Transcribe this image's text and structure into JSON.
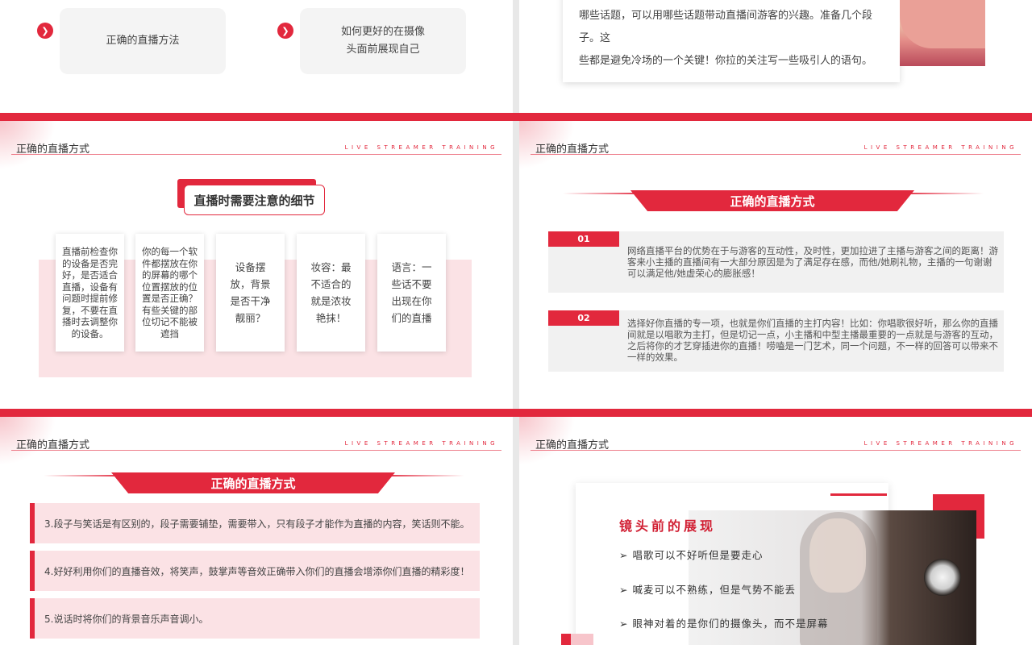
{
  "slide1": {
    "card1_text": "正确的直播方法",
    "card2_line1": "如何更好的在摄像",
    "card2_line2": "头面前展现自己",
    "arrow_icon": "chevron-right"
  },
  "slide2": {
    "line1": "哪些话题，可以用哪些话题带动直播间游客的兴趣。准备几个段子。这",
    "line2": "些都是避免冷场的一个关键！你拉的关注写一些吸引人的语句。"
  },
  "header": {
    "title": "正确的直播方式",
    "subtitle_en": "LIVE STREAMER TRAINING"
  },
  "slide3": {
    "tag": "直播时需要注意的细节",
    "cards": [
      "直播前检查你的设备是否完好，是否适合直播，设备有问题时提前修复，不要在直播时去调整你的设备。",
      "你的每一个软件都摆放在你的屏幕的哪个位置摆放的位置是否正确？有些关键的部位切记不能被遮挡",
      "设备摆放，背景是否干净靓丽？",
      "妆容：最不适合的就是浓妆艳抹！",
      "语言：一些话不要出现在你们的直播"
    ]
  },
  "slide4": {
    "banner": "正确的直播方式",
    "rows": [
      {
        "num": "01",
        "text": "网络直播平台的优势在于与游客的互动性，及时性，更加拉进了主播与游客之间的距离！游客来小主播的直播间有一大部分原因是为了满足存在感，而他/她刷礼物，主播的一句谢谢可以满足他/她虚荣心的膨胀感！"
      },
      {
        "num": "02",
        "text": "选择好你直播的专一项，也就是你们直播的主打内容！比如：你唱歌很好听，那么你的直播间就是以唱歌为主打，但是切记一点，小主播和中型主播最重要的一点就是与游客的互动，之后将你的才艺穿插进你的直播！唠嗑是一门艺术，同一个问题，不一样的回答可以带来不一样的效果。"
      }
    ]
  },
  "slide5": {
    "banner": "正确的直播方式",
    "rows": [
      "3.段子与笑话是有区别的，段子需要铺垫，需要带入，只有段子才能作为直播的内容，笑话则不能。",
      "4.好好利用你们的直播音效，将笑声，鼓掌声等音效正确带入你们的直播会增添你们直播的精彩度！",
      "5.说话时将你们的背景音乐声音调小。"
    ]
  },
  "slide6": {
    "title": "镜头前的展现",
    "bullet": "➢",
    "items": [
      "唱歌可以不好听但是要走心",
      "喊麦可以不熟练，但是气势不能丢",
      "眼神对着的是你们的摄像头，而不是屏幕"
    ]
  },
  "colors": {
    "accent": "#e2283d",
    "pink": "#fbe2e5",
    "card": "#f4f4f4"
  }
}
